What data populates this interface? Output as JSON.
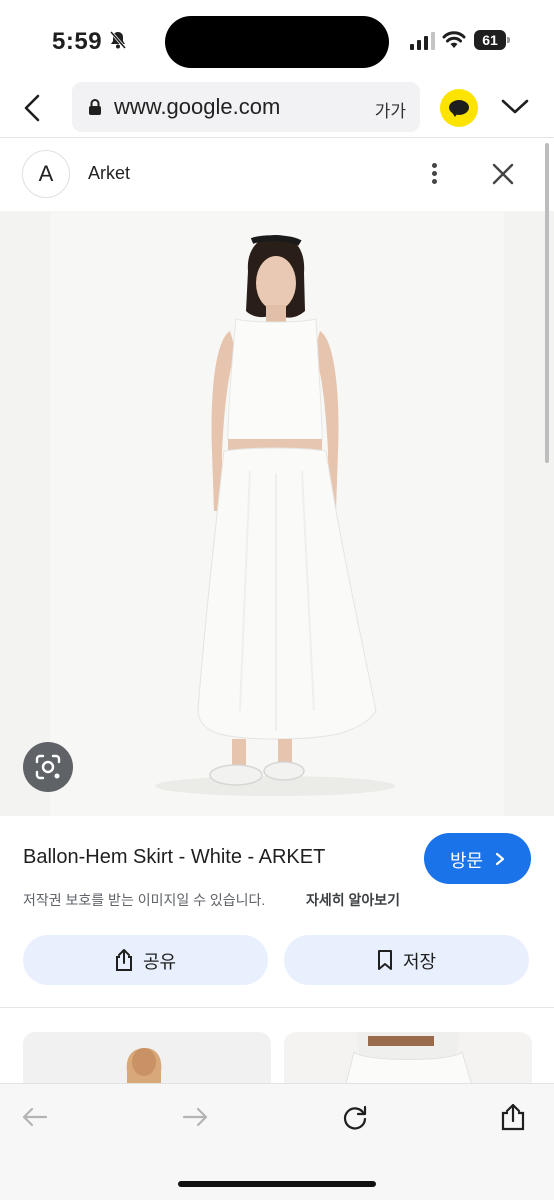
{
  "status_bar": {
    "time": "5:59",
    "battery": "61"
  },
  "browser": {
    "url": "www.google.com",
    "text_size_label": "가가"
  },
  "source": {
    "logo_letter": "A",
    "name": "Arket"
  },
  "product": {
    "title": "Ballon-Hem Skirt - White - ARKET",
    "visit_label": "방문",
    "copyright_notice": "저작권 보호를 받는 이미지일 수 있습니다.",
    "learn_more": "자세히 알아보기",
    "share_label": "공유",
    "save_label": "저장"
  },
  "colors": {
    "accent": "#1a73e8",
    "pill_bg": "#e8f0fd",
    "kakao": "#fde300"
  }
}
